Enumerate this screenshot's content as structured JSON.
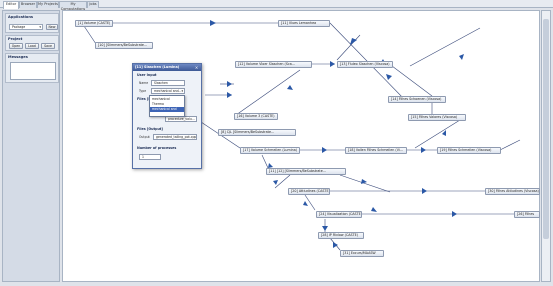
{
  "tabs": [
    "Editor",
    "Browser",
    "My Projects",
    "My Computations",
    "Jobs"
  ],
  "sidebar": {
    "applications": {
      "title": "Applications",
      "selected": "Package",
      "new_label": "New"
    },
    "project": {
      "title": "Project",
      "open_label": "Open",
      "load_label": "Load",
      "save_label": "Save"
    },
    "messages": {
      "title": "Messages"
    }
  },
  "nodes": {
    "n1": "[1] Volume (CASTE)",
    "n2": "[10] [Slimmers/BeSubstrate...",
    "n3": "[11] Vlues Lemanhea",
    "n4": "[12] Volume Vloer Slaschen (Sca...",
    "n5": "[13] Fluleo Slaschen (Viscosa)",
    "n6": "[14] Filhes Schoenen (Viscosa)",
    "n7": "[15] Filhes Valores (Viscosa)",
    "n8": "[16] Volume 3 (CASTE)",
    "n9": "[8] CJL [Slimmers/BeSubstrate...",
    "n10": "[17] Volume Schmeilen (Lumina)",
    "n11": "[18] Vollen Filhes Schmeilen (Vi...",
    "n12": "[19] Filhes Schmeilen (Viscosa)",
    "n13": "[11] [12] [Slimmers/BeSubstrate...",
    "n14": "[20] Attiudines (CASTE)",
    "n15": "[30] Filhes Attiudines (Viscosa)",
    "n16": "[24] Visualization (CASTE)",
    "n17": "[26] Filhes",
    "n18": "[28] IP Rivlow (CASTE)",
    "n19": "[31] Excurs/MAASW"
  },
  "dialog": {
    "title": "[11] Slaschen (Lumina)",
    "user_input_label": "User Input",
    "name_label": "Name",
    "name_value": "Slaschen",
    "type_label": "Type",
    "type_value": "mechanical and...",
    "files_input_label": "Files [Input]",
    "input_value": "procedure_valu...",
    "files_output_label": "Files [Output]",
    "output_label": "Output",
    "output_value": "generated_tailing_pot.cpp",
    "processes_label": "Number of processes",
    "processes_value": "1"
  },
  "dropdown": {
    "options": [
      "mechanical",
      "Thermo",
      "mechanical and thermal"
    ],
    "selected_index": 2
  }
}
